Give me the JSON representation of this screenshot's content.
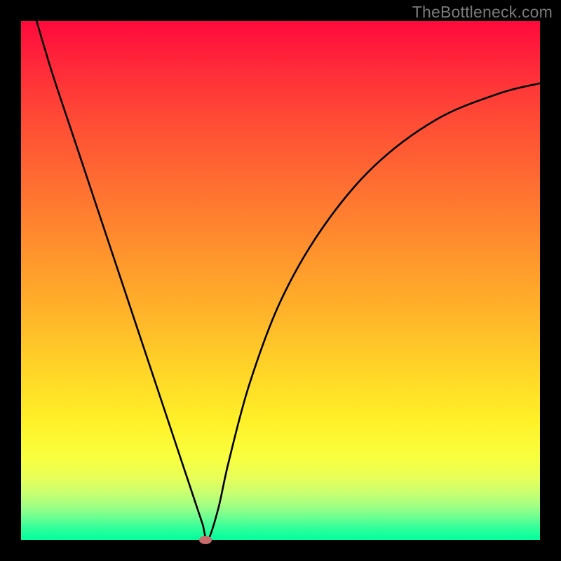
{
  "watermark": "TheBottleneck.com",
  "chart_data": {
    "type": "line",
    "title": "",
    "xlabel": "",
    "ylabel": "",
    "xlim": [
      0,
      100
    ],
    "ylim": [
      0,
      100
    ],
    "grid": false,
    "legend": false,
    "background": "rainbow-gradient",
    "series": [
      {
        "name": "bottleneck-curve",
        "color": "#000000",
        "x": [
          3,
          6,
          10,
          14,
          18,
          22,
          26,
          30,
          32,
          34,
          35,
          36,
          38,
          40,
          44,
          50,
          58,
          68,
          80,
          92,
          100
        ],
        "y": [
          100,
          90,
          78,
          66,
          54,
          42,
          30,
          18,
          12,
          6,
          3,
          0,
          6,
          15,
          30,
          46,
          60,
          72,
          81,
          86,
          88
        ]
      }
    ],
    "marker": {
      "x": 35.5,
      "y": 0,
      "color": "#c96b6b"
    }
  },
  "colors": {
    "frame": "#000000",
    "watermark": "#7a7a7a"
  }
}
